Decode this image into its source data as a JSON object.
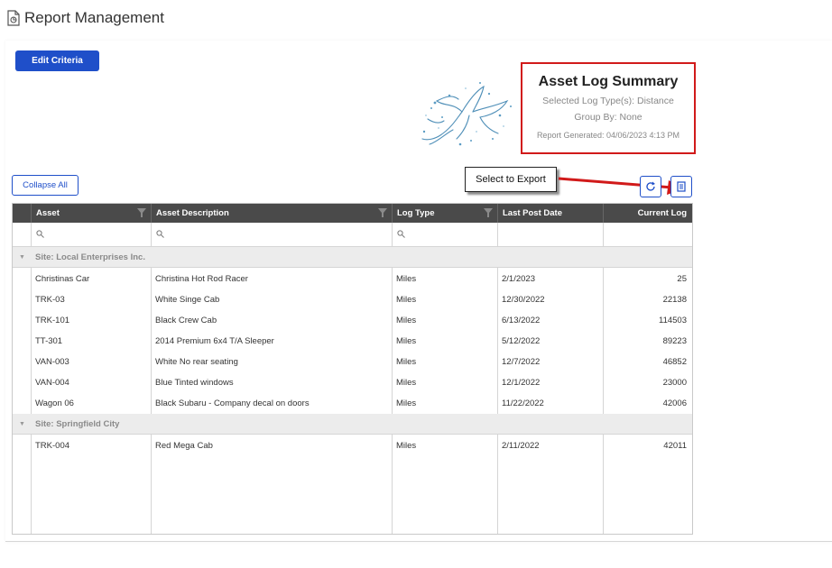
{
  "page": {
    "title": "Report Management"
  },
  "toolbar": {
    "edit_criteria_label": "Edit Criteria",
    "collapse_all_label": "Collapse All"
  },
  "summary": {
    "title": "Asset Log Summary",
    "log_types": "Selected Log Type(s): Distance",
    "group_by": "Group By: None",
    "generated": "Report Generated: 04/06/2023 4:13 PM"
  },
  "callout": {
    "text": "Select to Export",
    "border_color": "#222222",
    "arrow_color": "#d11a1a"
  },
  "icons": {
    "refresh": "refresh-icon",
    "export": "export-icon",
    "filter": "filter-icon",
    "search": "search-icon"
  },
  "grid": {
    "columns": [
      "Asset",
      "Asset Description",
      "Log Type",
      "Last Post Date",
      "Current Log"
    ],
    "groups": [
      {
        "label": "Site: Local Enterprises Inc.",
        "rows": [
          [
            "Christinas Car",
            "Christina Hot Rod Racer",
            "Miles",
            "2/1/2023",
            "25"
          ],
          [
            "TRK-03",
            "White Singe Cab",
            "Miles",
            "12/30/2022",
            "22138"
          ],
          [
            "TRK-101",
            "Black Crew Cab",
            "Miles",
            "6/13/2022",
            "114503"
          ],
          [
            "TT-301",
            "2014 Premium 6x4 T/A Sleeper",
            "Miles",
            "5/12/2022",
            "89223"
          ],
          [
            "VAN-003",
            "White No rear seating",
            "Miles",
            "12/7/2022",
            "46852"
          ],
          [
            "VAN-004",
            "Blue Tinted windows",
            "Miles",
            "12/1/2022",
            "23000"
          ],
          [
            "Wagon 06",
            "Black Subaru - Company decal on doors",
            "Miles",
            "11/22/2022",
            "42006"
          ]
        ]
      },
      {
        "label": "Site: Springfield City",
        "rows": [
          [
            "TRK-004",
            "Red Mega Cab",
            "Miles",
            "2/11/2022",
            "42011"
          ]
        ]
      }
    ]
  },
  "colors": {
    "accent": "#1f4fc9",
    "header_bg": "#4a4a4a",
    "group_bg": "#ececec",
    "highlight": "#d11a1a"
  }
}
